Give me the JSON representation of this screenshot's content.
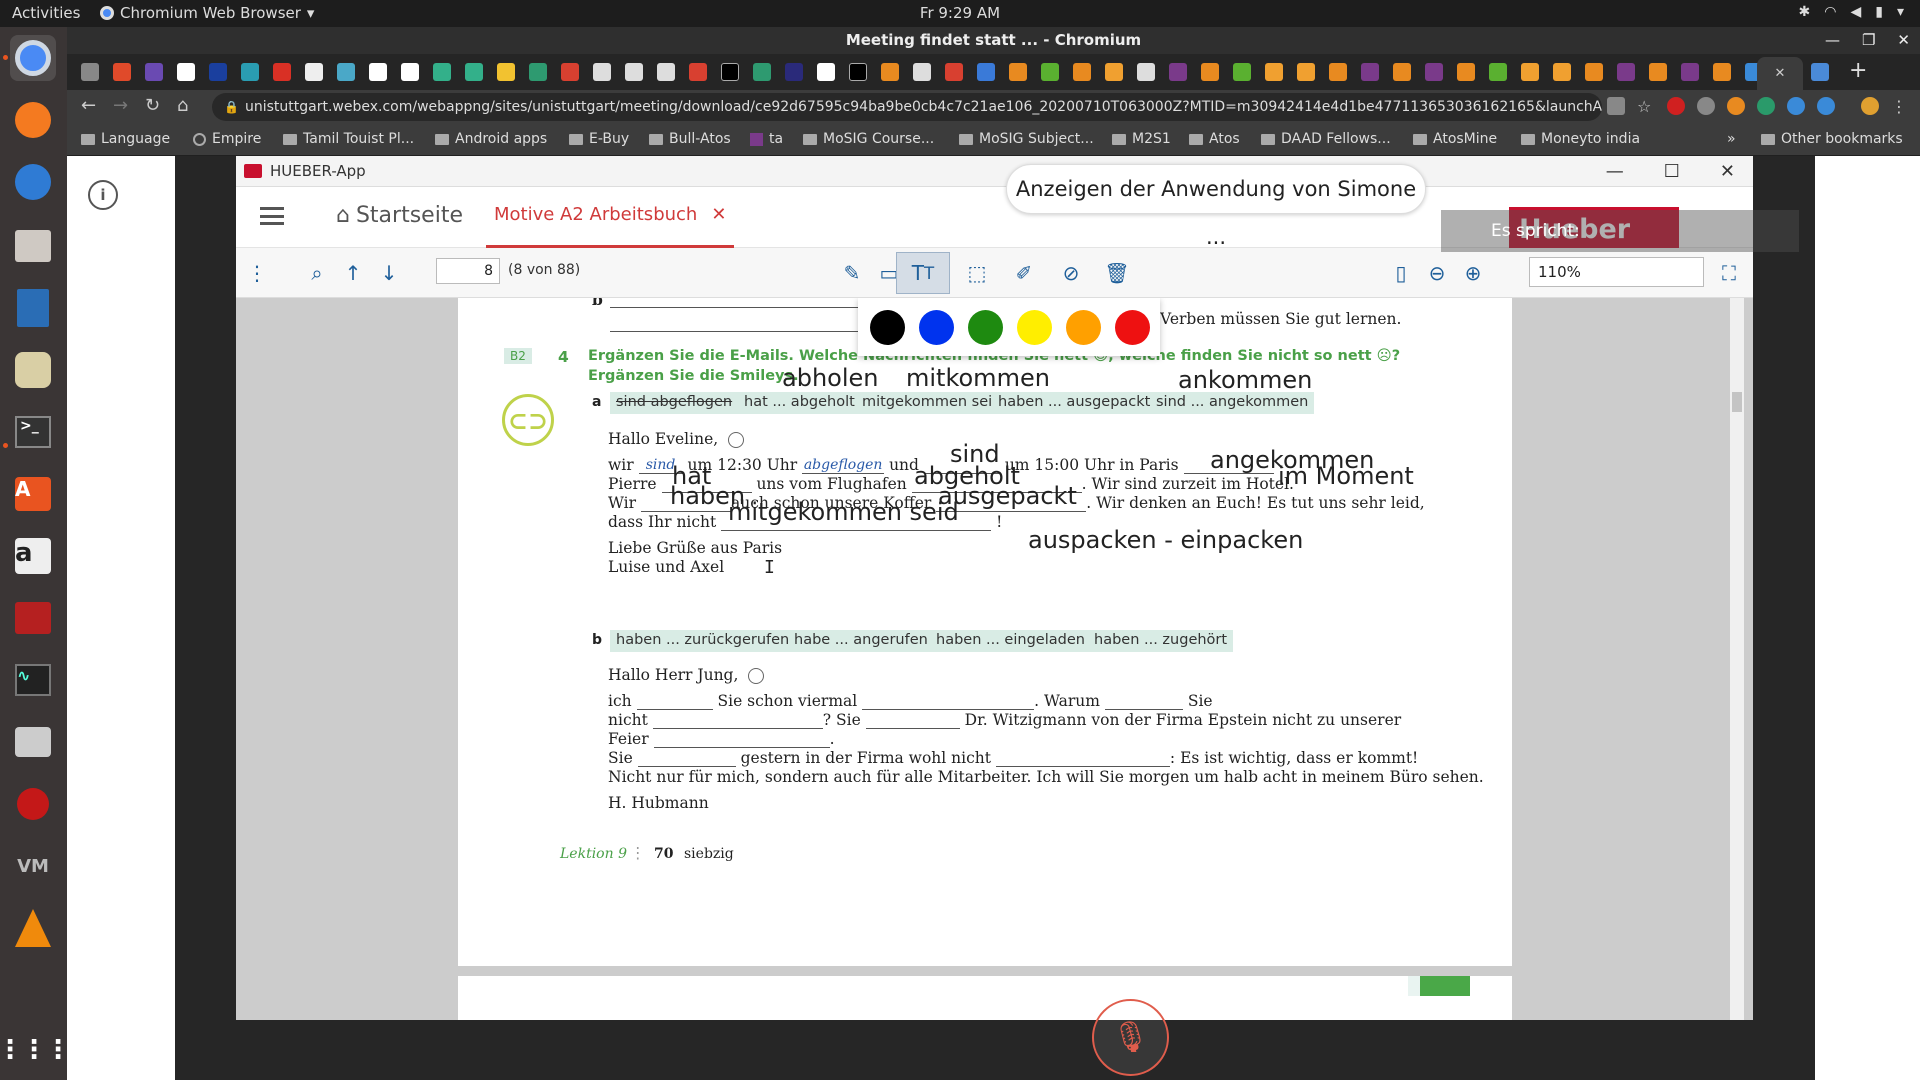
{
  "os": {
    "activities": "Activities",
    "app_name": "Chromium Web Browser",
    "clock": "Fr  9:29 AM"
  },
  "browser": {
    "window_title": "Meeting findet statt ... - Chromium",
    "url": "unistuttgart.webex.com/webappng/sites/unistuttgart/meeting/download/ce92d67595c94ba9be0cb4c7c21ae106_20200710T063000Z?MTID=m30942414e4d1be477113653036162165&launchApp...",
    "bookmarks": [
      "Language",
      "Empire",
      "Tamil Touist Pl...",
      "Android apps",
      "E-Buy",
      "Bull-Atos",
      "ta",
      "MoSIG Course...",
      "MoSIG Subject...",
      "M2S1",
      "Atos",
      "DAAD Fellows...",
      "AtosMine",
      "Moneyto india"
    ],
    "bookmarks_more": "»",
    "other_bookmarks": "Other bookmarks"
  },
  "share": {
    "banner": "Anzeigen der Anwendung von Simone ...",
    "speaking_label": "Es spricht:",
    "window_title": "HUEBER-App",
    "startseite": "Startseite",
    "tab": "Motive A2 Arbeitsbuch",
    "brand": "Hueber",
    "page_number": "8",
    "page_count": "(8 von 88)",
    "zoom": "110%"
  },
  "colors": {
    "palette": [
      "#000000",
      "#0033ee",
      "#1e8a10",
      "#ffee00",
      "#ffa000",
      "#ee1111"
    ],
    "accent": "#d03a3a"
  },
  "doc": {
    "top_text": "se Verben müssen Sie gut lernen.",
    "top_letter": "b",
    "section": "B2",
    "number": "4",
    "instruction1": "Ergänzen Sie die E-Mails. Welche Nachrichten finden Sie nett ☺, welche finden Sie nicht so nett ☹?",
    "instruction2": "Ergänzen Sie die Smileys.",
    "label_a": "a",
    "words_a": [
      "sind abgeflogen",
      "hat ... abgeholt",
      "mitgekommen seid",
      "haben ... ausgepackt",
      "sind ... angekommen"
    ],
    "greeting_a": "Hallo Eveline,",
    "a_l1_1": "wir",
    "a_l1_fill1": "sind",
    "a_l1_2": "um 12:30 Uhr",
    "a_l1_fill2": "abgeflogen",
    "a_l1_3": "und",
    "a_l1_4": "um 15:00 Uhr in Paris",
    "a_l2_1": "Pierre",
    "a_l2_2": "uns vom Flughafen",
    "a_l2_3": ". Wir sind zurzeit im Hotel.",
    "a_l3_1": "Wir",
    "a_l3_2": "auch schon unsere Koffer",
    "a_l3_3": ". Wir denken an Euch! Es tut uns sehr leid,",
    "a_l4_1": "dass Ihr nicht",
    "a_l4_2": "!",
    "a_close1": "Liebe Grüße aus Paris",
    "a_close2": "Luise und Axel",
    "label_b": "b",
    "words_b": [
      "haben ... zurückgerufen",
      "habe ... angerufen",
      "haben ... eingeladen",
      "haben ... zugehört"
    ],
    "greeting_b": "Hallo Herr Jung,",
    "b_l1_1": "ich",
    "b_l1_2": "Sie schon viermal",
    "b_l1_3": ". Warum",
    "b_l1_4": "Sie",
    "b_l2_1": "nicht",
    "b_l2_2": "? Sie",
    "b_l2_3": "Dr. Witzigmann von der Firma Epstein nicht zu unserer",
    "b_l3_1": "Feier",
    "b_l3_2": ".",
    "b_l4_1": "Sie",
    "b_l4_2": "gestern in der Firma wohl nicht",
    "b_l4_3": ": Es ist wichtig, dass er kommt!",
    "b_l5": "Nicht nur für mich, sondern auch für alle Mitarbeiter. Ich will Sie morgen um halb acht in meinem Büro sehen.",
    "b_sign": "H. Hubmann",
    "footer_lesson": "Lektion 9",
    "footer_num": "70",
    "footer_word": "siebzig"
  },
  "annotations": {
    "abholen": "abholen",
    "mitkommen": "mitkommen",
    "ankommen": "ankommen",
    "sind": "sind",
    "angekommen": "angekommen",
    "hat": "hat",
    "abgeholt": "abgeholt",
    "im_moment": "im Moment",
    "haben": "haben",
    "ausgepackt": "ausgepackt",
    "mitgekommen_seid": "mitgekommen seid",
    "auspacken": "auspacken -  einpacken"
  }
}
